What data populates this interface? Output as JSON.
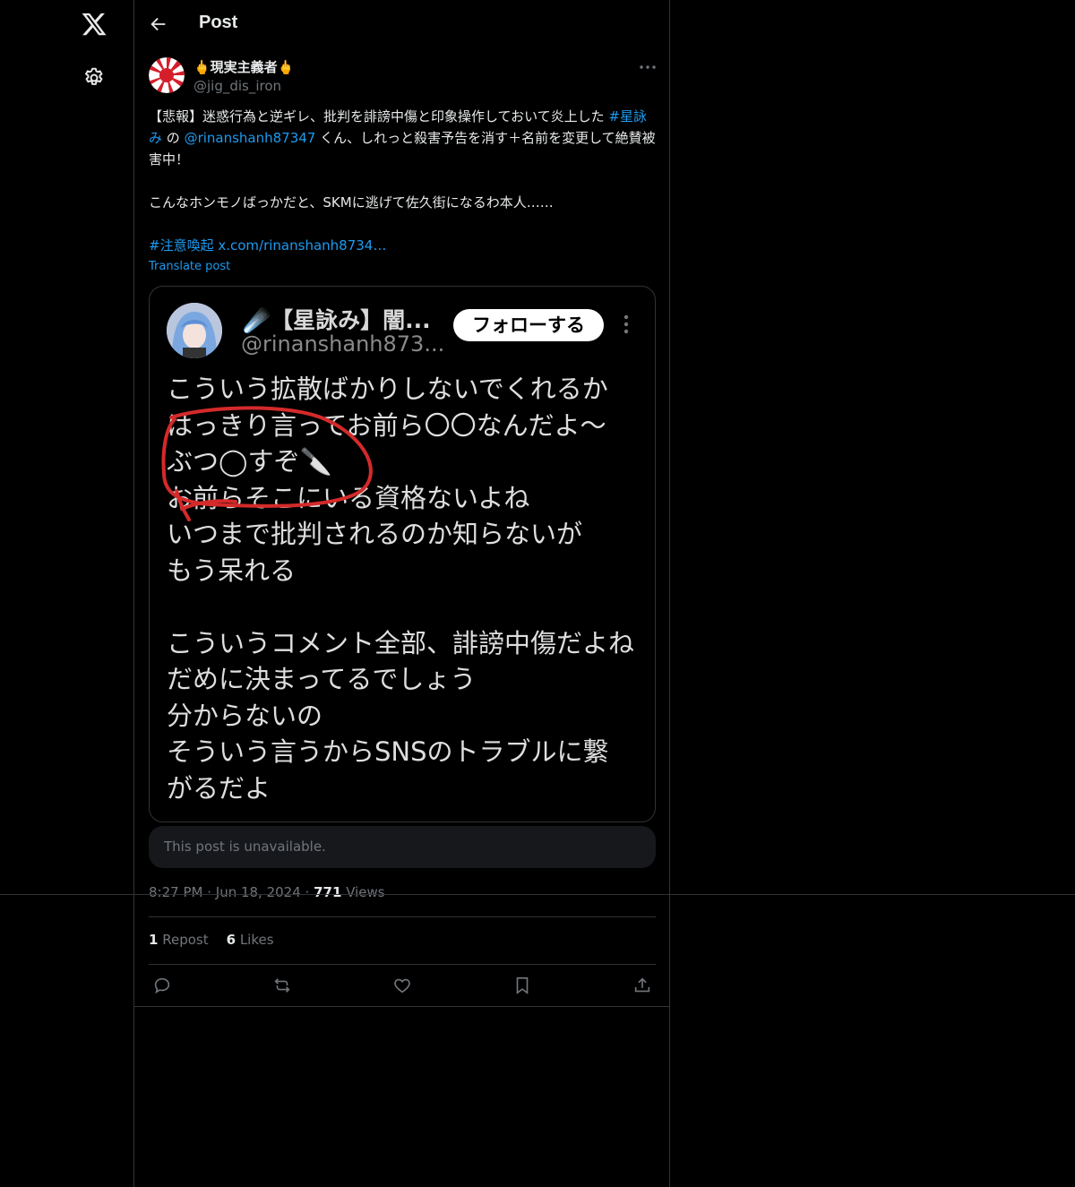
{
  "sidebar": {
    "logo_icon": "x-logo",
    "settings_icon": "gear-icon"
  },
  "header": {
    "title": "Post",
    "back_icon": "arrow-left-icon"
  },
  "post": {
    "author_name": "🖕現実主義者🖕",
    "author_handle": "@jig_dis_iron",
    "text_part1": "【悲報】迷惑行為と逆ギレ、批判を誹謗中傷と印象操作しておいて炎上した ",
    "hashtag1": "#星詠み",
    "text_part2": " の ",
    "mention": "@rinanshanh87347",
    "text_part3": " くん、しれっと殺害予告を消す＋名前を変更して絶賛被害中！\n\nこんなホンモノばっかだと、SKMに逃げて佐久街になるわ本人……\n\n",
    "hashtag2": "#注意喚起",
    "link_url": "x.com/rinanshanh8734…",
    "translate_label": "Translate post",
    "unavailable_text": "This post is unavailable.",
    "time": "8:27 PM",
    "date": "Jun 18, 2024",
    "views_count": "771",
    "views_label": "Views",
    "reposts_count": "1",
    "reposts_label": "Repost",
    "likes_count": "6",
    "likes_label": "Likes"
  },
  "media_screenshot": {
    "name": "☄️【星詠み】闇...",
    "handle": "@rinanshanh873...",
    "follow_label": "フォローする",
    "text": "こういう拡散ばかりしないでくれるか\nはっきり言ってお前ら〇〇なんだよ～\nぶつ◯すぞ🔪\nお前らそこにいる資格ないよね\nいつまで批判されるのか知らないが\nもう呆れる\n\nこういうコメント全部、誹謗中傷だよね\nだめに決まってるでしょう\n分からないの\nそういう言うからSNSのトラブルに繋\nがるだよ",
    "annotation_color": "#d42a2a"
  },
  "actions": [
    "reply-icon",
    "repost-icon",
    "like-icon",
    "bookmark-icon",
    "share-icon"
  ]
}
